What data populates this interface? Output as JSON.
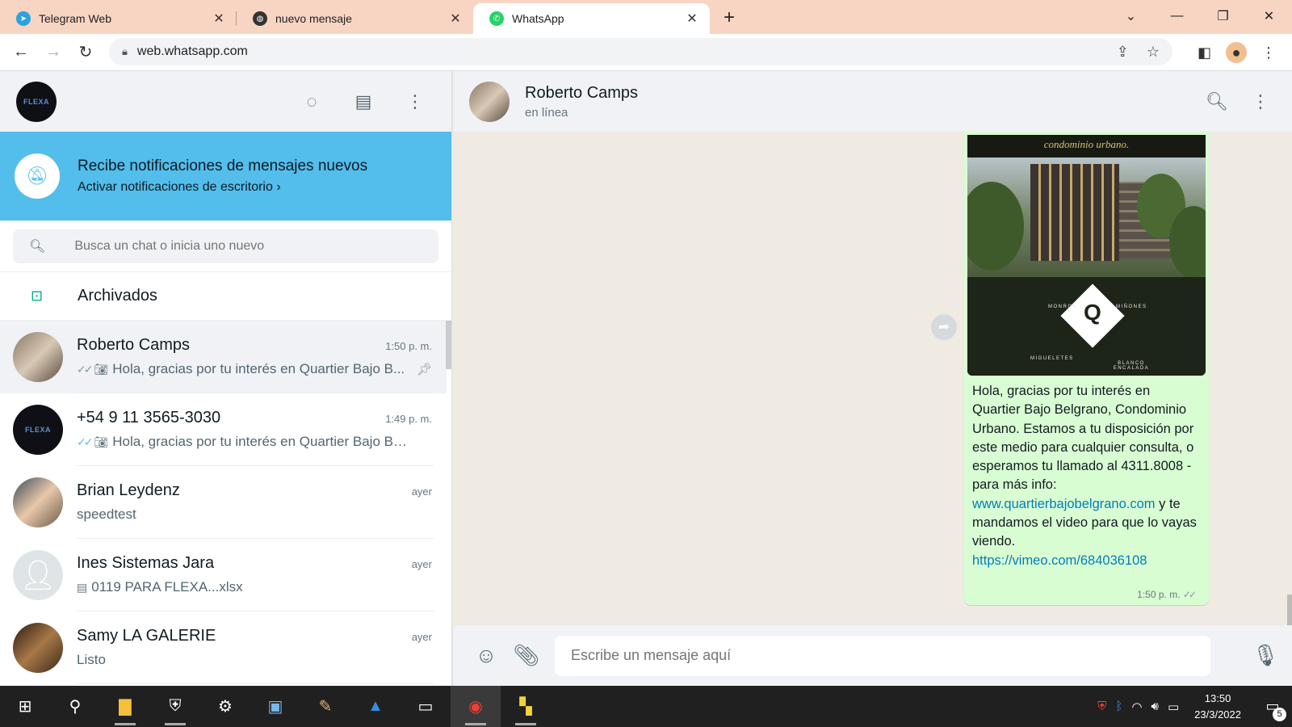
{
  "browser": {
    "tabs": [
      {
        "title": "Telegram Web"
      },
      {
        "title": "nuevo mensaje"
      },
      {
        "title": "WhatsApp"
      }
    ],
    "url": "web.whatsapp.com"
  },
  "sidebar": {
    "user_avatar_text": "FLEXA",
    "notification": {
      "title": "Recibe notificaciones de mensajes nuevos",
      "action": "Activar notificaciones de escritorio"
    },
    "search_placeholder": "Busca un chat o inicia uno nuevo",
    "archived_label": "Archivados",
    "chats": [
      {
        "name": "Roberto Camps",
        "time": "1:50 p. m.",
        "preview": "Hola, gracias por tu interés en Quartier Bajo B...",
        "pinned": true
      },
      {
        "name": "+54 9 11 3565-3030",
        "time": "1:49 p. m.",
        "preview": "Hola, gracias por tu interés en Quartier Bajo Bel..."
      },
      {
        "name": "Brian Leydenz",
        "time": "ayer",
        "preview": "speedtest"
      },
      {
        "name": "Ines Sistemas Jara",
        "time": "ayer",
        "preview": "0119 PARA FLEXA...xlsx"
      },
      {
        "name": "Samy LA GALERIE",
        "time": "ayer",
        "preview": "Listo"
      }
    ]
  },
  "conversation": {
    "contact_name": "Roberto Camps",
    "contact_status": "en línea",
    "message": {
      "image_banner": "condominio urbano.",
      "image_labels": [
        "MONROE",
        "MIÑONES",
        "MIGUELETES",
        "BLANCO ENCALADA"
      ],
      "image_letter": "Q",
      "text": "Hola, gracias por tu interés en Quartier Bajo Belgrano, Condominio Urbano. Estamos a tu disposición por este medio para cualquier consulta, o esperamos tu llamado al 4311.8008  - para más info:",
      "link1": "www.quartierbajobelgrano.com",
      "text2": " y te mandamos el video para que lo vayas viendo.",
      "link2": "https://vimeo.com/684036108",
      "time": "1:50 p. m."
    },
    "input_placeholder": "Escribe un mensaje aquí"
  },
  "taskbar": {
    "time": "13:50",
    "date": "23/3/2022",
    "notification_count": "5"
  },
  "colors": {
    "accent": "#00a884",
    "notification_bg": "#53bdeb",
    "outgoing_bubble": "#d9fdd3",
    "chat_bg": "#efeae2",
    "tab_bar": "#f8d5c3"
  }
}
